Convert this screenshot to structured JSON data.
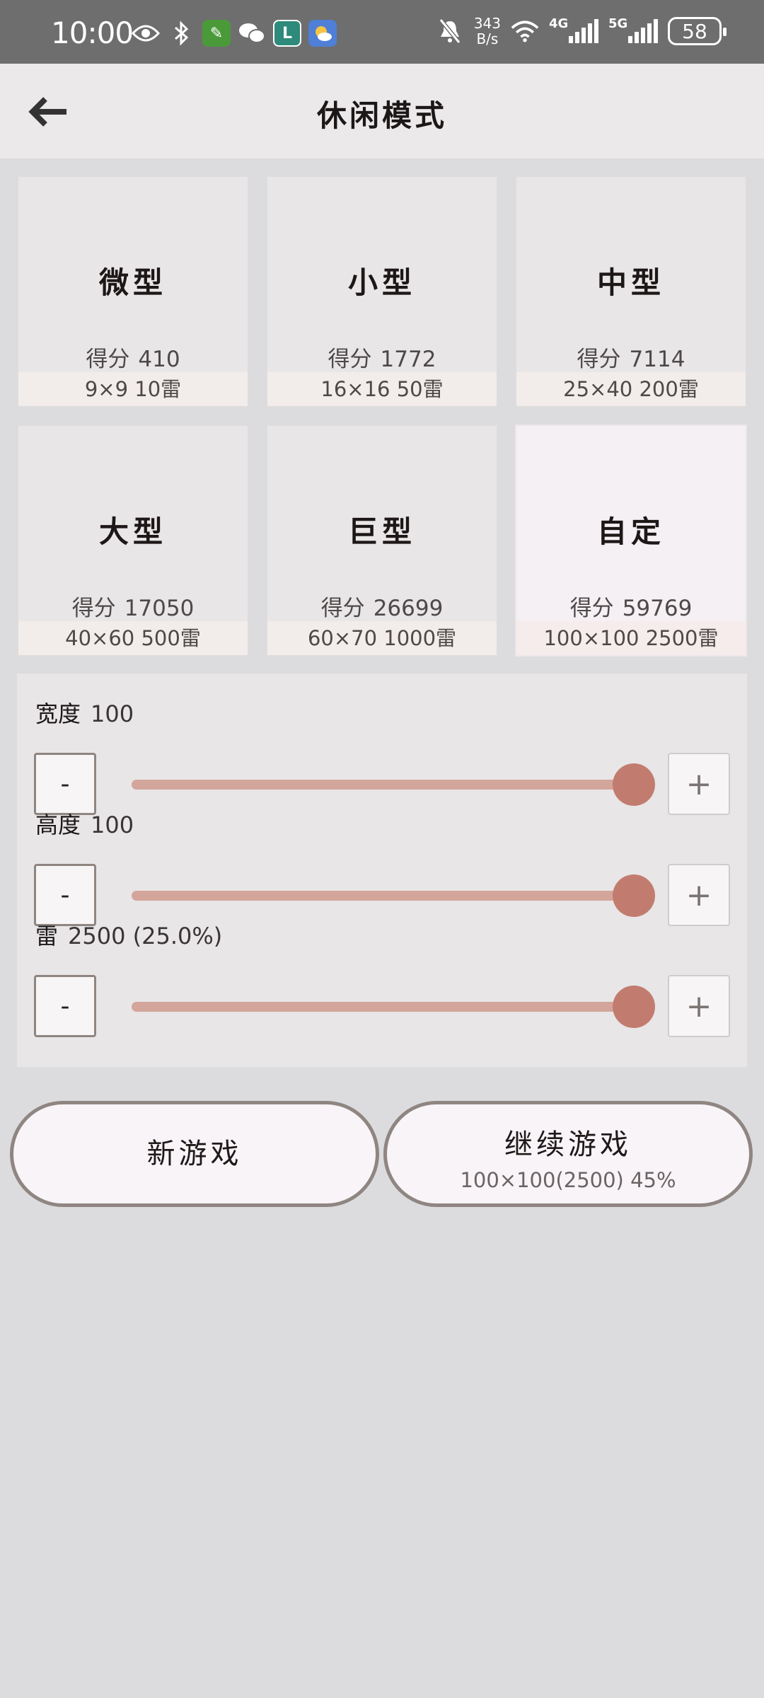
{
  "status_bar": {
    "time": "10:00",
    "net_speed": "343",
    "net_unit": "B/s",
    "signal_1": "4G",
    "signal_2": "5G",
    "battery": "58",
    "icons": [
      "eye-icon",
      "bluetooth-icon",
      "app-icon",
      "wechat-icon",
      "app-icon",
      "weather-icon",
      "mute-bell-icon",
      "wifi-icon"
    ]
  },
  "header": {
    "title": "休闲模式",
    "back_icon": "arrow-left-icon"
  },
  "score_label": "得分",
  "modes": [
    {
      "name": "微型",
      "score": "410",
      "info": "9×9  10雷"
    },
    {
      "name": "小型",
      "score": "1772",
      "info": "16×16  50雷"
    },
    {
      "name": "中型",
      "score": "7114",
      "info": "25×40  200雷"
    },
    {
      "name": "大型",
      "score": "17050",
      "info": "40×60  500雷"
    },
    {
      "name": "巨型",
      "score": "26699",
      "info": "60×70  1000雷"
    },
    {
      "name": "自定",
      "score": "59769",
      "info": "100×100  2500雷",
      "selected": true
    }
  ],
  "settings": {
    "width": {
      "label": "宽度",
      "value": "100",
      "level": 1.0
    },
    "height": {
      "label": "高度",
      "value": "100",
      "level": 1.0
    },
    "mines": {
      "label": "雷",
      "value": "2500 (25.0%)",
      "level": 1.0
    },
    "minus_label": "-",
    "plus_label": "+"
  },
  "buttons": {
    "new_game": "新游戏",
    "continue_game": "继续游戏",
    "continue_info": "100×100(2500) 45%"
  },
  "colors": {
    "accent": "#c27c6f",
    "track_fill": "#d4a59b",
    "button_border": "#8f8581"
  }
}
